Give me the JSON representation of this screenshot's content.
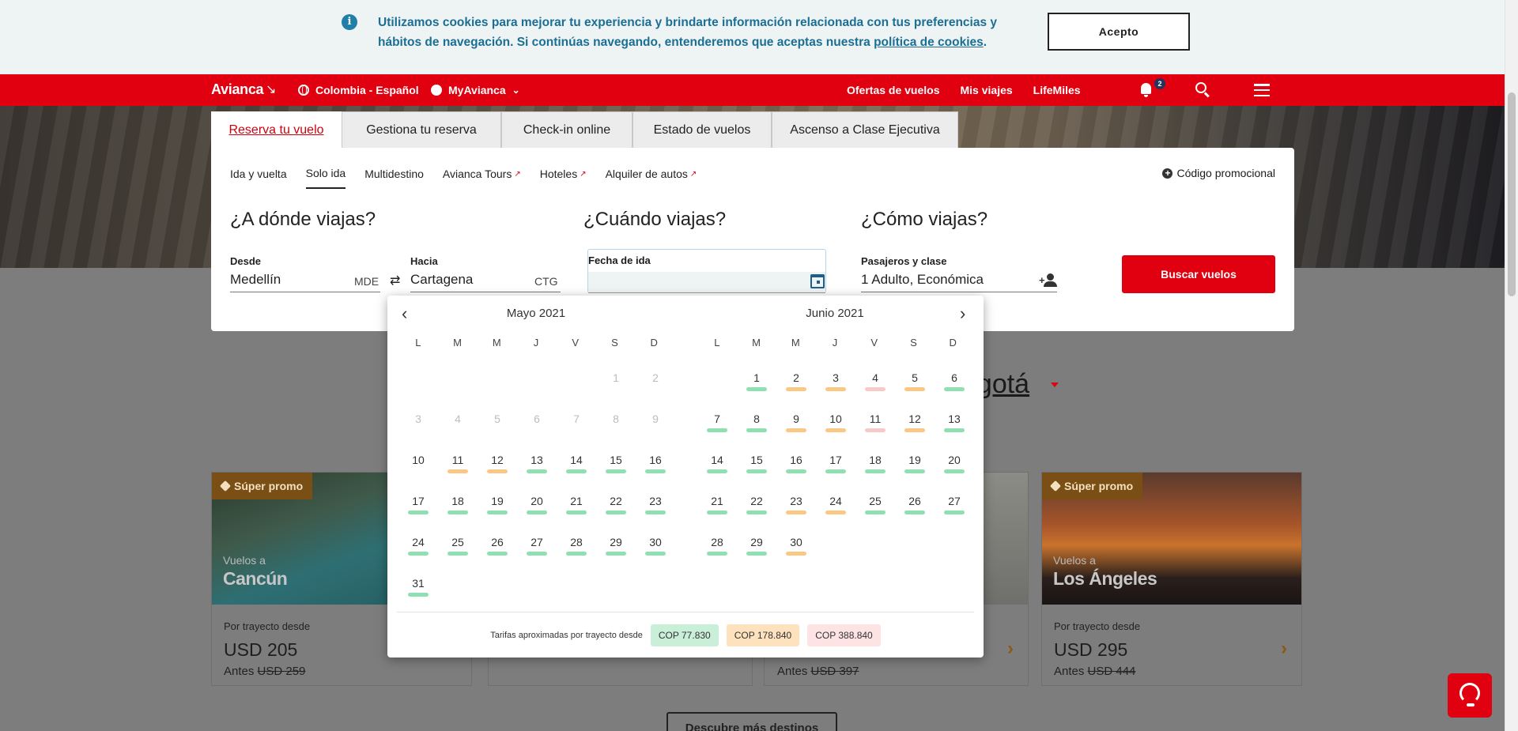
{
  "cookie": {
    "message": "Utilizamos cookies para mejorar tu experiencia y brindarte información relacionada con tus preferencias y hábitos de navegación. Si continúas navegando, entenderemos que aceptas nuestra ",
    "policy_link": "política de cookies",
    "period": ".",
    "accept": "Acepto"
  },
  "nav": {
    "logo": "Avianca",
    "country": "Colombia - Español",
    "myavianca": "MyAvianca",
    "links": [
      "Ofertas de vuelos",
      "Mis viajes",
      "LifeMiles"
    ],
    "notifications": "2",
    "accent_color": "#e1000f"
  },
  "booking": {
    "tabs": [
      "Reserva tu vuelo",
      "Gestiona tu reserva",
      "Check-in online",
      "Estado de vuelos",
      "Ascenso a Clase Ejecutiva"
    ],
    "active_tab": 0,
    "subtabs": [
      "Ida y vuelta",
      "Solo ida",
      "Multidestino",
      "Avianca Tours",
      "Hoteles",
      "Alquiler de autos"
    ],
    "active_subtab": 1,
    "promo_code": "Código promocional",
    "where_title": "¿A dónde viajas?",
    "when_title": "¿Cuándo viajas?",
    "how_title": "¿Cómo viajas?",
    "from_label": "Desde",
    "from_value": "Medellín",
    "from_code": "MDE",
    "to_label": "Hacia",
    "to_value": "Cartagena",
    "to_code": "CTG",
    "date_label": "Fecha de ida",
    "date_value": "",
    "pax_label": "Pasajeros y clase",
    "pax_value": "1 Adulto, Económica",
    "search_button": "Buscar vuelos"
  },
  "section_heading_partial": "ogotá",
  "calendar": {
    "weekdays": [
      "L",
      "M",
      "M",
      "J",
      "V",
      "S",
      "D"
    ],
    "months": [
      {
        "title": "Mayo 2021",
        "offset": 5,
        "days": 31,
        "disabled_until": 10,
        "fares": {
          "11": "o",
          "12": "o",
          "13": "g",
          "14": "g",
          "15": "g",
          "16": "g",
          "17": "g",
          "18": "g",
          "19": "g",
          "20": "g",
          "21": "g",
          "22": "g",
          "23": "g",
          "24": "g",
          "25": "g",
          "26": "g",
          "27": "g",
          "28": "g",
          "29": "g",
          "30": "g",
          "31": "g"
        }
      },
      {
        "title": "Junio 2021",
        "offset": 1,
        "days": 30,
        "disabled_until": 0,
        "fares": {
          "1": "g",
          "2": "o",
          "3": "o",
          "4": "p",
          "5": "o",
          "6": "g",
          "7": "g",
          "8": "g",
          "9": "o",
          "10": "o",
          "11": "p",
          "12": "o",
          "13": "g",
          "14": "g",
          "15": "g",
          "16": "g",
          "17": "g",
          "18": "g",
          "19": "g",
          "20": "g",
          "21": "g",
          "22": "g",
          "23": "o",
          "24": "o",
          "25": "g",
          "26": "g",
          "27": "g",
          "28": "g",
          "29": "g",
          "30": "o"
        }
      }
    ],
    "legend_label": "Tarifas aproximadas por trayecto desde",
    "legend": [
      {
        "key": "g",
        "label": "COP 77.830",
        "color": "#c9efd9",
        "bar": "#8fe0b1"
      },
      {
        "key": "o",
        "label": "COP 178.840",
        "color": "#fde2bd",
        "bar": "#fbc785"
      },
      {
        "key": "p",
        "label": "COP 388.840",
        "color": "#fde3e3",
        "bar": "#f8c9c9"
      }
    ]
  },
  "cards": [
    {
      "badge": "Súper promo",
      "to": "Vuelos a",
      "city": "Cancún",
      "from_label": "Por trayecto desde",
      "price": "USD 205",
      "before_label": "Antes",
      "before_price": "USD 259"
    },
    {
      "badge": "Súper promo",
      "to": "Vuelos a",
      "city": "Los Ángeles",
      "from_label": "Por trayecto desde",
      "price": "USD 295",
      "before_label": "Antes",
      "before_price": "USD 444"
    }
  ],
  "partial_card": {
    "before_label": "Antes",
    "before_price": "USD 397"
  },
  "more_destinations": "Descubre más destinos"
}
